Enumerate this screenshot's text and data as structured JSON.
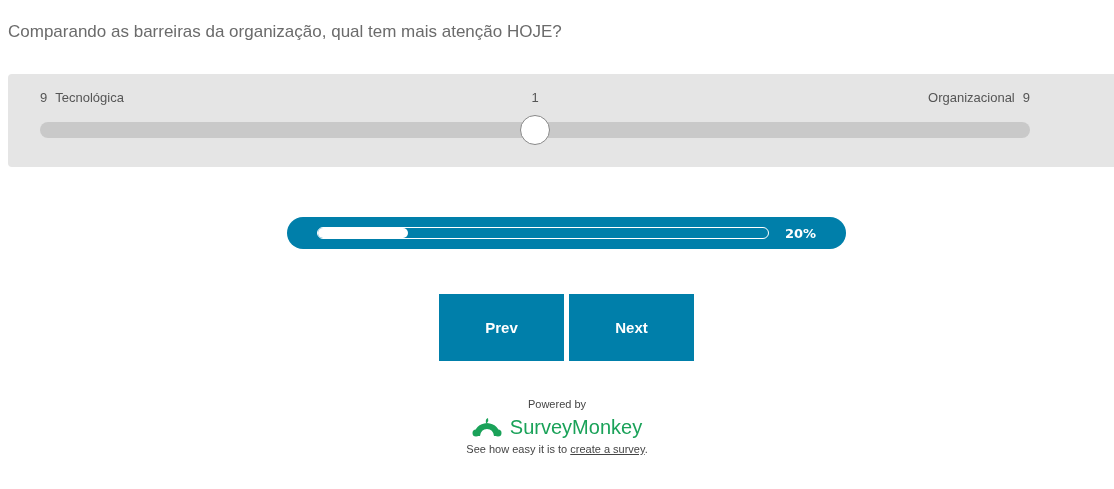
{
  "question": "Comparando as barreiras da organização, qual tem mais atenção HOJE?",
  "slider": {
    "left_value": "9",
    "left_label": "Tecnológica",
    "center_value": "1",
    "right_label": "Organizacional",
    "right_value": "9",
    "level": 0.5
  },
  "progress": {
    "level": 0.2,
    "reading": "20%"
  },
  "buttons": [
    {
      "label": "Prev"
    },
    {
      "label": "Next"
    }
  ],
  "footer": {
    "powered_by": "Powered by",
    "brand": "SurveyMonkey",
    "text_before": "See how easy it is to ",
    "link": "create a survey",
    "text_after": "."
  }
}
